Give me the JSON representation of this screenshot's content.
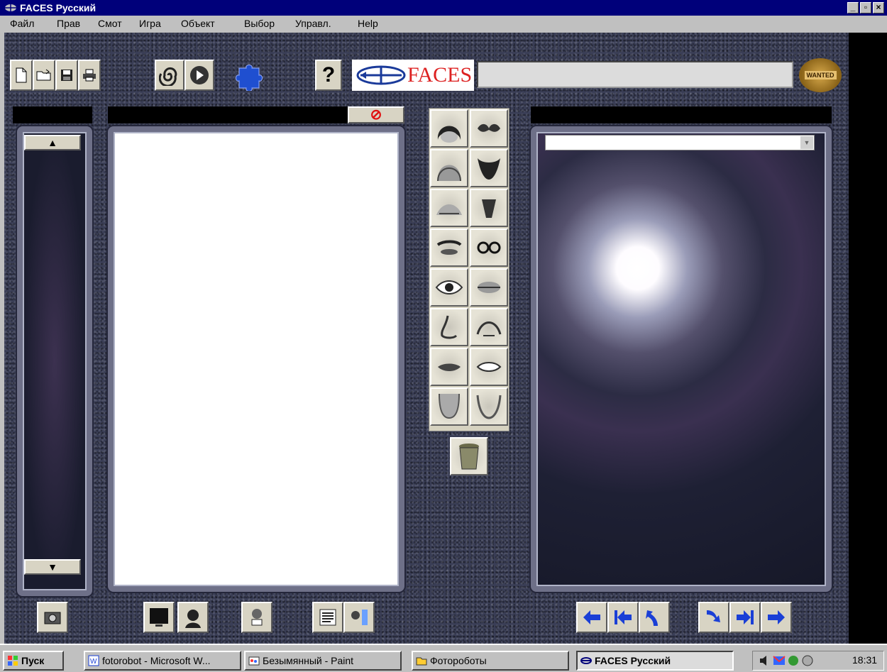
{
  "window": {
    "title": "FACES Русский"
  },
  "menu": [
    "Файл",
    "Прав",
    "Смот",
    "Игра",
    "Объект",
    "Выбор",
    "Управл.",
    "Help"
  ],
  "toolbar": {
    "logo_text": "FACES",
    "search_value": "",
    "help_glyph": "?",
    "badge_text": "WANTED"
  },
  "lists": {
    "left_up": "▲",
    "left_down": "▼",
    "composite_clear": "⊘",
    "dropdown_value": ""
  },
  "features": [
    {
      "name": "hair"
    },
    {
      "name": "mustache"
    },
    {
      "name": "head-shape"
    },
    {
      "name": "beard"
    },
    {
      "name": "forehead"
    },
    {
      "name": "goatee"
    },
    {
      "name": "eyebrows"
    },
    {
      "name": "glasses"
    },
    {
      "name": "eyes"
    },
    {
      "name": "lips-closeup"
    },
    {
      "name": "nose"
    },
    {
      "name": "cheeks"
    },
    {
      "name": "mouth"
    },
    {
      "name": "mouth-open"
    },
    {
      "name": "chin"
    },
    {
      "name": "jaw"
    }
  ],
  "taskbar": {
    "start_label": "Пуск",
    "tasks": [
      "fotorobot - Microsoft W...",
      "Безымянный - Paint",
      "Фотороботы",
      "FACES Русский"
    ],
    "clock": "18:31"
  },
  "colors": {
    "title_bg": "#00007a",
    "arrow": "#1a3fd6",
    "clear_red": "#e01010"
  }
}
